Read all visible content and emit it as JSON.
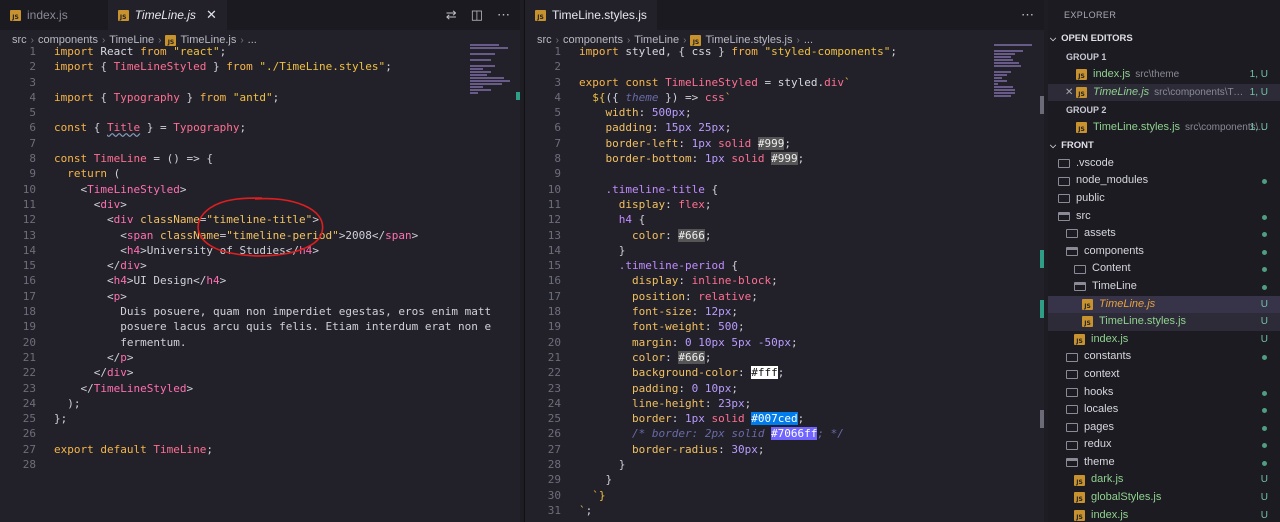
{
  "left": {
    "tabs": [
      {
        "label": "index.js",
        "active": false
      },
      {
        "label": "TimeLine.js",
        "active": true
      }
    ],
    "breadcrumb": [
      "src",
      "components",
      "TimeLine",
      "TimeLine.js",
      "..."
    ],
    "lines": [
      "<span class='kw'>import</span> <span class='plain'>React</span> <span class='kw'>from</span> <span class='str'>\"react\"</span>;",
      "<span class='kw'>import</span> { <span class='fn'>TimeLineStyled</span> } <span class='kw'>from</span> <span class='str'>\"./TimeLine.styles\"</span>;",
      "",
      "<span class='kw'>import</span> { <span class='fn'>Typography</span> } <span class='kw'>from</span> <span class='str'>\"antd\"</span>;",
      "",
      "<span class='kw'>const</span> { <span class='fn squig'>Title</span> } = <span class='fn'>Typography</span>;",
      "",
      "<span class='kw'>const</span> <span class='fn'>TimeLine</span> = () =&gt; {",
      "  <span class='kw'>return</span> (",
      "    &lt;<span class='tag'>TimeLineStyled</span>&gt;",
      "      &lt;<span class='tag'>div</span>&gt;",
      "        &lt;<span class='tag'>div</span> <span class='attr'>className</span>=<span class='val'>\"timeline-title\"</span>&gt;",
      "          &lt;<span class='tag'>span</span> <span class='attr'>className</span>=<span class='val'>\"timeline-period\"</span>&gt;2008&lt;/<span class='tag'>span</span>&gt;",
      "          &lt;<span class='tag'>h4</span>&gt;University of Studies&lt;/<span class='tag'>h4</span>&gt;",
      "        &lt;/<span class='tag'>div</span>&gt;",
      "        &lt;<span class='tag'>h4</span>&gt;UI Design&lt;/<span class='tag'>h4</span>&gt;",
      "        &lt;<span class='tag'>p</span>&gt;",
      "          Duis posuere, quam non imperdiet egestas, eros enim matt",
      "          posuere lacus arcu quis felis. Etiam interdum erat non e",
      "          fermentum.",
      "        &lt;/<span class='tag'>p</span>&gt;",
      "      &lt;/<span class='tag'>div</span>&gt;",
      "    &lt;/<span class='tag'>TimeLineStyled</span>&gt;",
      "  );",
      "};",
      "",
      "<span class='kw'>export</span> <span class='kw'>default</span> <span class='fn'>TimeLine</span>;",
      ""
    ]
  },
  "right": {
    "tabs": [
      {
        "label": "TimeLine.styles.js",
        "active": true
      }
    ],
    "breadcrumb": [
      "src",
      "components",
      "TimeLine",
      "TimeLine.styles.js",
      "..."
    ],
    "lines": [
      "<span class='kw'>import</span> <span class='plain'>styled</span>, { <span class='plain'>css</span> } <span class='kw'>from</span> <span class='str'>\"styled-components\"</span>;",
      "",
      "<span class='kw'>export</span> <span class='kw'>const</span> <span class='fn'>TimeLineStyled</span> = <span class='plain'>styled</span>.<span class='fn'>div</span><span class='str'>`</span>",
      "  <span class='str'>${</span>({ <span class='cm'>theme</span> }) =&gt; <span class='fn'>css</span><span class='str'>`</span>",
      "    <span class='prop'>width</span>: <span class='num'>500px</span>;",
      "    <span class='prop'>padding</span>: <span class='num'>15px 25px</span>;",
      "    <span class='prop'>border-left</span>: <span class='num'>1px</span> <span class='fn'>solid</span> <span class='hexbox'>#999</span>;",
      "    <span class='prop'>border-bottom</span>: <span class='num'>1px</span> <span class='fn'>solid</span> <span class='hexbox'>#999</span>;",
      "",
      "    <span class='sel'>.timeline-title</span> {",
      "      <span class='prop'>display</span>: <span class='fn'>flex</span>;",
      "      <span class='sel'>h4</span> {",
      "        <span class='prop'>color</span>: <span class='hexbox'>#666</span>;",
      "      }",
      "      <span class='sel'>.timeline-period</span> {",
      "        <span class='prop'>display</span>: <span class='fn'>inline-block</span>;",
      "        <span class='prop'>position</span>: <span class='fn'>relative</span>;",
      "        <span class='prop'>font-size</span>: <span class='num'>12px</span>;",
      "        <span class='prop'>font-weight</span>: <span class='num'>500</span>;",
      "        <span class='prop'>margin</span>: <span class='num'>0 10px 5px -50px</span>;",
      "        <span class='prop'>color</span>: <span class='hexbox'>#666</span>;",
      "        <span class='prop'>background-color</span>: <span class='hexwhite'>#fff</span>;",
      "        <span class='prop'>padding</span>: <span class='num'>0 10px</span>;",
      "        <span class='prop'>line-height</span>: <span class='num'>23px</span>;",
      "        <span class='prop'>border</span>: <span class='num'>1px</span> <span class='fn'>solid</span> <span class='hexblue'>#007ced</span>;",
      "        <span class='cm'>/* border: 2px solid </span><span class='hexpurple'>#7066ff</span><span class='cm'>; */</span>",
      "        <span class='prop'>border-radius</span>: <span class='num'>30px</span>;",
      "      }",
      "    }",
      "  <span class='str'>`}</span>",
      "<span class='str'>`</span>;"
    ]
  },
  "sidebar": {
    "title": "EXPLORER",
    "open_editors_label": "OPEN EDITORS",
    "group1_label": "GROUP 1",
    "group2_label": "GROUP 2",
    "open_editors_g1": [
      {
        "name": "index.js",
        "desc": "src\\theme",
        "badge": "1, U"
      },
      {
        "name": "TimeLine.js",
        "desc": "src\\components\\Time...",
        "badge": "1, U"
      }
    ],
    "open_editors_g2": [
      {
        "name": "TimeLine.styles.js",
        "desc": "src\\components\\...",
        "badge": "1, U"
      }
    ],
    "project_label": "FRONT",
    "tree": [
      {
        "name": ".vscode",
        "type": "folder",
        "depth": 0,
        "mark": ""
      },
      {
        "name": "node_modules",
        "type": "folder",
        "depth": 0,
        "mark": "dot"
      },
      {
        "name": "public",
        "type": "folder",
        "depth": 0,
        "mark": ""
      },
      {
        "name": "src",
        "type": "folder-open",
        "depth": 0,
        "mark": "dot"
      },
      {
        "name": "assets",
        "type": "folder",
        "depth": 1,
        "mark": "dot"
      },
      {
        "name": "components",
        "type": "folder-open",
        "depth": 1,
        "mark": "dot"
      },
      {
        "name": "Content",
        "type": "folder",
        "depth": 2,
        "mark": "dot"
      },
      {
        "name": "TimeLine",
        "type": "folder-open",
        "depth": 2,
        "mark": "dot"
      },
      {
        "name": "TimeLine.js",
        "type": "js",
        "depth": 3,
        "mark": "U",
        "state": "active"
      },
      {
        "name": "TimeLine.styles.js",
        "type": "js",
        "depth": 3,
        "mark": "U",
        "state": "selected"
      },
      {
        "name": "index.js",
        "type": "js",
        "depth": 2,
        "mark": "U"
      },
      {
        "name": "constants",
        "type": "folder",
        "depth": 1,
        "mark": "dot"
      },
      {
        "name": "context",
        "type": "folder",
        "depth": 1,
        "mark": ""
      },
      {
        "name": "hooks",
        "type": "folder",
        "depth": 1,
        "mark": "dot"
      },
      {
        "name": "locales",
        "type": "folder",
        "depth": 1,
        "mark": "dot"
      },
      {
        "name": "pages",
        "type": "folder",
        "depth": 1,
        "mark": "dot"
      },
      {
        "name": "redux",
        "type": "folder",
        "depth": 1,
        "mark": "dot"
      },
      {
        "name": "theme",
        "type": "folder-open",
        "depth": 1,
        "mark": "dot"
      },
      {
        "name": "dark.js",
        "type": "js",
        "depth": 2,
        "mark": "U"
      },
      {
        "name": "globalStyles.js",
        "type": "js",
        "depth": 2,
        "mark": "U"
      },
      {
        "name": "index.js",
        "type": "js",
        "depth": 2,
        "mark": "U"
      }
    ]
  },
  "colors": {
    "accent_blue": "#007ced",
    "accent_purple": "#7066ff",
    "annotation_red": "#e01e1e",
    "git_untracked": "#6fc3a6"
  }
}
